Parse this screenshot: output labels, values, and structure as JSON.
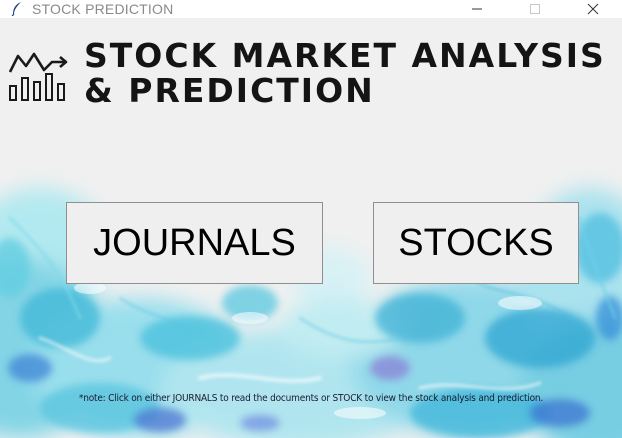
{
  "window": {
    "title": "STOCK PREDICTION",
    "icon": "feather-icon",
    "controls": [
      "minimize-icon",
      "maximize-icon",
      "close-icon"
    ]
  },
  "header": {
    "logo_icon": "stock-chart-logo-icon",
    "title": "STOCK MARKET ANALYSIS & PREDICTION"
  },
  "buttons": {
    "journals_label": "JOURNALS",
    "stocks_label": "STOCKS"
  },
  "footer": {
    "note": "*note: Click on either JOURNALS to read the documents or STOCK to view the stock analysis and prediction."
  },
  "colors": {
    "background": "#f0f0f0",
    "watercolor_cyan": "#5fd3e6",
    "watercolor_blue": "#3a8fd8",
    "watercolor_purple": "#8a7bd6",
    "heading_text": "#141414",
    "button_bg": "#efefef",
    "button_border": "#8f8f8f"
  }
}
